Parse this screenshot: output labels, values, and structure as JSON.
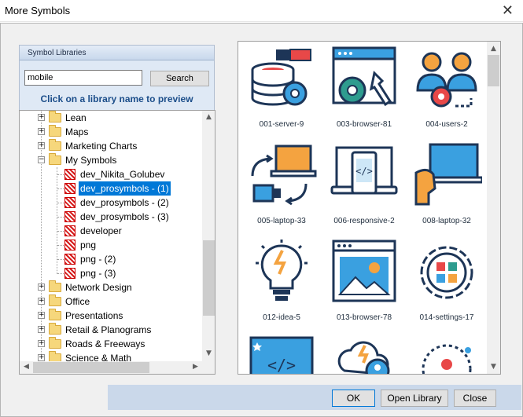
{
  "window": {
    "title": "More Symbols",
    "close_glyph": "✕"
  },
  "left_panel": {
    "header": "Symbol Libraries",
    "search_value": "mobile",
    "search_button": "Search",
    "hint": "Click on a library name to preview"
  },
  "tree": {
    "expand_glyph": "+",
    "collapse_glyph": "−",
    "items": [
      {
        "label": "Lean"
      },
      {
        "label": "Maps"
      },
      {
        "label": "Marketing Charts"
      },
      {
        "label": "My Symbols"
      },
      {
        "label": "dev_Nikita_Golubev"
      },
      {
        "label": "dev_prosymbols - (1)",
        "selected": true
      },
      {
        "label": "dev_prosymbols - (2)"
      },
      {
        "label": "dev_prosymbols - (3)"
      },
      {
        "label": "developer"
      },
      {
        "label": "png"
      },
      {
        "label": "png - (2)"
      },
      {
        "label": "png - (3)"
      },
      {
        "label": "Network Design"
      },
      {
        "label": "Office"
      },
      {
        "label": "Presentations"
      },
      {
        "label": "Retail & Planograms"
      },
      {
        "label": "Roads & Freeways"
      },
      {
        "label": "Science & Math"
      }
    ]
  },
  "gallery": {
    "items": [
      {
        "label": "001-server-9",
        "icon": "server-icon"
      },
      {
        "label": "003-browser-81",
        "icon": "browser-settings-icon"
      },
      {
        "label": "004-users-2",
        "icon": "users-icon"
      },
      {
        "label": "005-laptop-33",
        "icon": "laptop-transfer-icon"
      },
      {
        "label": "006-responsive-2",
        "icon": "responsive-icon"
      },
      {
        "label": "008-laptop-32",
        "icon": "laptop-user-icon"
      },
      {
        "label": "012-idea-5",
        "icon": "idea-icon"
      },
      {
        "label": "013-browser-78",
        "icon": "browser-image-icon"
      },
      {
        "label": "014-settings-17",
        "icon": "settings-icon"
      },
      {
        "label": "",
        "icon": "code-window-icon"
      },
      {
        "label": "",
        "icon": "cloud-icon"
      },
      {
        "label": "",
        "icon": "user-circle-icon"
      }
    ]
  },
  "buttons": {
    "ok": "OK",
    "open_library": "Open Library",
    "close": "Close"
  },
  "colors": {
    "selection": "#0078d7",
    "hint_text": "#1c4e8a",
    "icon_navy": "#1d3557",
    "icon_blue": "#3aa0e0",
    "icon_orange": "#f4a340",
    "icon_red": "#e84848",
    "icon_teal": "#2e9c8f"
  }
}
